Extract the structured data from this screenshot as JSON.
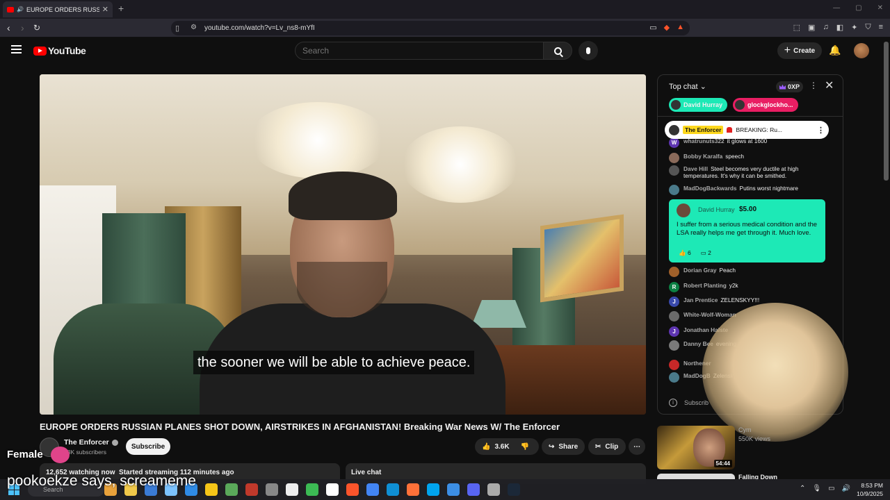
{
  "browser": {
    "tab_title": "EUROPE ORDERS RUSSIAN PL",
    "url": "youtube.com/watch?v=Lv_ns8-mYfI",
    "badge_count": "1"
  },
  "header": {
    "logo_text": "YouTube",
    "search_placeholder": "Search",
    "create_label": "Create"
  },
  "video": {
    "caption": "the sooner we will be able to achieve peace.",
    "title": "EUROPE ORDERS RUSSIAN PLANES SHOT DOWN, AIRSTRIKES IN AFGHANISTAN! Breaking War News W/ The Enforcer",
    "channel_name": "The Enforcer",
    "subscribers": "43K subscribers",
    "subscribe_label": "Subscribe",
    "likes": "3.6K",
    "share_label": "Share",
    "clip_label": "Clip",
    "watching": "12,652 watching now",
    "started": "Started streaming 112 minutes ago",
    "live_chat_label": "Live chat"
  },
  "chat": {
    "mode_label": "Top chat",
    "xp": "0XP",
    "chips": [
      {
        "name": "David Hurray",
        "color": "#1de9b6"
      },
      {
        "name": "glockglockho...",
        "color": "#e91e63"
      }
    ],
    "pinned": {
      "author": "The Enforcer",
      "text": "BREAKING: Ru..."
    },
    "messages": [
      {
        "initial": "W",
        "color": "#5e35b1",
        "author": "whatrunuts322",
        "text": "it glows at 1600"
      },
      {
        "initial": "",
        "color": "#8a6a5a",
        "author": "Bobby Karalfa",
        "text": "speech"
      },
      {
        "initial": "",
        "color": "#555555",
        "author": "Dave Hill",
        "text": "Steel becomes very ductile at high temperatures. It's why it can be smithed."
      },
      {
        "initial": "",
        "color": "#4a7a8a",
        "author": "MadDogBackwards",
        "text": "Putins worst nightmare"
      },
      {
        "initial": "",
        "color": "#a0602a",
        "author": "Dorian Gray",
        "text": "Peach"
      },
      {
        "initial": "R",
        "color": "#0b8043",
        "author": "Robert Planting",
        "text": "y2k"
      },
      {
        "initial": "J",
        "color": "#3949ab",
        "author": "Jan Prentice",
        "text": "ZELENSKYY!!!"
      },
      {
        "initial": "",
        "color": "#6a6a6a",
        "author": "White-Wolf-Woman",
        "text": ""
      },
      {
        "initial": "J",
        "color": "#5e35b1",
        "author": "Jonathan Halste",
        "text": ""
      },
      {
        "initial": "",
        "color": "#7a7a7a",
        "author": "Danny Bee",
        "text": "evening"
      },
      {
        "initial": "",
        "color": "#c62828",
        "author": "Northener",
        "text": ""
      },
      {
        "initial": "",
        "color": "#4a7a8a",
        "author": "MadDogB",
        "text": "Zelensky"
      }
    ],
    "superchat": {
      "author": "David Hurray",
      "amount": "$5.00",
      "text": "I suffer from a serious medical condition and the LSA really helps me get through it. Much love.",
      "likes": "6",
      "replies": "2"
    },
    "subscribe_hint": "Subscrib"
  },
  "recommendation": {
    "duration": "54:44",
    "channel": "Cym",
    "views": "550K views",
    "next_title": "Falling Down"
  },
  "overlays": {
    "female_label": "Female",
    "tts_text": "pookoekze says, screameme"
  },
  "taskbar": {
    "search_label": "Search",
    "time": "8:53 PM",
    "date": "10/9/2025",
    "icons": [
      "#e9a23b",
      "#f0c84a",
      "#3a7bd5",
      "#7cc3ff",
      "#2f8be6",
      "#f5c518",
      "#5aa85a",
      "#c0392b",
      "#888",
      "#eee",
      "#3cba54",
      "#fff",
      "#fb542b",
      "#4285f4",
      "#0f8fd5",
      "#ff7139",
      "#00a4ef",
      "#3c8ee5",
      "#5865f2",
      "#aaa",
      "#1b2838"
    ]
  }
}
